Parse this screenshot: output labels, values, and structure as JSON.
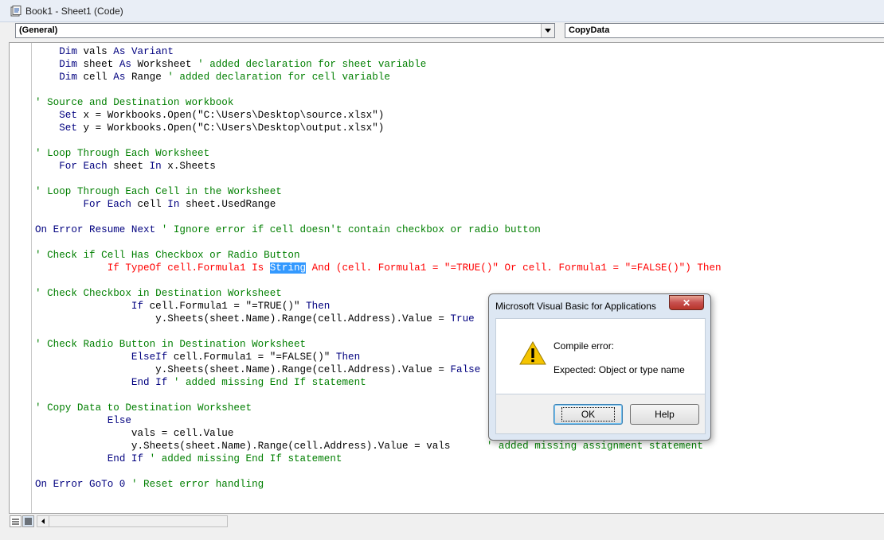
{
  "window": {
    "title": "Book1 - Sheet1 (Code)"
  },
  "combos": {
    "object_value": "(General)",
    "procedure_value": "CopyData"
  },
  "code_lines": [
    [
      {
        "t": "    ",
        "c": "pl"
      },
      {
        "t": "Dim",
        "c": "kw"
      },
      {
        "t": " vals ",
        "c": "pl"
      },
      {
        "t": "As",
        "c": "kw"
      },
      {
        "t": " ",
        "c": "pl"
      },
      {
        "t": "Variant",
        "c": "kw"
      }
    ],
    [
      {
        "t": "    ",
        "c": "pl"
      },
      {
        "t": "Dim",
        "c": "kw"
      },
      {
        "t": " sheet ",
        "c": "pl"
      },
      {
        "t": "As",
        "c": "kw"
      },
      {
        "t": " Worksheet ",
        "c": "pl"
      },
      {
        "t": "' added declaration for sheet variable",
        "c": "cm"
      }
    ],
    [
      {
        "t": "    ",
        "c": "pl"
      },
      {
        "t": "Dim",
        "c": "kw"
      },
      {
        "t": " cell ",
        "c": "pl"
      },
      {
        "t": "As",
        "c": "kw"
      },
      {
        "t": " Range ",
        "c": "pl"
      },
      {
        "t": "' added declaration for cell variable",
        "c": "cm"
      }
    ],
    [],
    [
      {
        "t": "' Source and Destination workbook",
        "c": "cm"
      }
    ],
    [
      {
        "t": "    ",
        "c": "pl"
      },
      {
        "t": "Set",
        "c": "kw"
      },
      {
        "t": " x = Workbooks.Open(\"C:\\Users\\Desktop\\source.xlsx\")",
        "c": "pl"
      }
    ],
    [
      {
        "t": "    ",
        "c": "pl"
      },
      {
        "t": "Set",
        "c": "kw"
      },
      {
        "t": " y = Workbooks.Open(\"C:\\Users\\Desktop\\output.xlsx\")",
        "c": "pl"
      }
    ],
    [],
    [
      {
        "t": "' Loop Through Each Worksheet",
        "c": "cm"
      }
    ],
    [
      {
        "t": "    ",
        "c": "pl"
      },
      {
        "t": "For Each",
        "c": "kw"
      },
      {
        "t": " sheet ",
        "c": "pl"
      },
      {
        "t": "In",
        "c": "kw"
      },
      {
        "t": " x.Sheets",
        "c": "pl"
      }
    ],
    [],
    [
      {
        "t": "' Loop Through Each Cell in the Worksheet",
        "c": "cm"
      }
    ],
    [
      {
        "t": "        ",
        "c": "pl"
      },
      {
        "t": "For Each",
        "c": "kw"
      },
      {
        "t": " cell ",
        "c": "pl"
      },
      {
        "t": "In",
        "c": "kw"
      },
      {
        "t": " sheet.UsedRange",
        "c": "pl"
      }
    ],
    [],
    [
      {
        "t": "On Error Resume Next",
        "c": "kw"
      },
      {
        "t": " ",
        "c": "pl"
      },
      {
        "t": "' Ignore error if cell doesn't contain checkbox or radio button",
        "c": "cm"
      }
    ],
    [],
    [
      {
        "t": "' Check if Cell Has Checkbox or Radio Button",
        "c": "cm"
      }
    ],
    [
      {
        "t": "            If TypeOf cell.Formula1 Is ",
        "c": "err"
      },
      {
        "t": "String",
        "c": "sel"
      },
      {
        "t": " And (cell. Formula1 = \"=TRUE()\" Or cell. Formula1 = \"=FALSE()\") Then",
        "c": "err"
      }
    ],
    [],
    [
      {
        "t": "' Check Checkbox in Destination Worksheet",
        "c": "cm"
      }
    ],
    [
      {
        "t": "                ",
        "c": "pl"
      },
      {
        "t": "If",
        "c": "kw"
      },
      {
        "t": " cell.Formula1 = \"=TRUE()\" ",
        "c": "pl"
      },
      {
        "t": "Then",
        "c": "kw"
      }
    ],
    [
      {
        "t": "                    y.Sheets(sheet.Name).Range(cell.Address).Value = ",
        "c": "pl"
      },
      {
        "t": "True",
        "c": "kw"
      }
    ],
    [],
    [
      {
        "t": "' Check Radio Button in Destination Worksheet",
        "c": "cm"
      }
    ],
    [
      {
        "t": "                ",
        "c": "pl"
      },
      {
        "t": "ElseIf",
        "c": "kw"
      },
      {
        "t": " cell.Formula1 = \"=FALSE()\" ",
        "c": "pl"
      },
      {
        "t": "Then",
        "c": "kw"
      }
    ],
    [
      {
        "t": "                    y.Sheets(sheet.Name).Range(cell.Address).Value = ",
        "c": "pl"
      },
      {
        "t": "False",
        "c": "kw"
      }
    ],
    [
      {
        "t": "                ",
        "c": "pl"
      },
      {
        "t": "End If",
        "c": "kw"
      },
      {
        "t": " ",
        "c": "pl"
      },
      {
        "t": "' added missing End If statement",
        "c": "cm"
      }
    ],
    [],
    [
      {
        "t": "' Copy Data to Destination Worksheet",
        "c": "cm"
      }
    ],
    [
      {
        "t": "            ",
        "c": "pl"
      },
      {
        "t": "Else",
        "c": "kw"
      }
    ],
    [
      {
        "t": "                vals = cell.Value",
        "c": "pl"
      }
    ],
    [
      {
        "t": "                y.Sheets(sheet.Name).Range(cell.Address).Value = vals      ",
        "c": "pl"
      },
      {
        "t": "' added missing assignment statement",
        "c": "cm"
      }
    ],
    [
      {
        "t": "            ",
        "c": "pl"
      },
      {
        "t": "End If",
        "c": "kw"
      },
      {
        "t": " ",
        "c": "pl"
      },
      {
        "t": "' added missing End If statement",
        "c": "cm"
      }
    ],
    [],
    [
      {
        "t": "On Error GoTo 0",
        "c": "kw"
      },
      {
        "t": " ",
        "c": "pl"
      },
      {
        "t": "' Reset error handling",
        "c": "cm"
      }
    ]
  ],
  "dialog": {
    "title": "Microsoft Visual Basic for Applications",
    "close_glyph": "✕",
    "message_title": "Compile error:",
    "message_detail": "Expected: Object or type name",
    "ok_label": "OK",
    "help_label": "Help",
    "icon": "warning-icon"
  },
  "colors": {
    "keyword": "#00007f",
    "comment": "#007f00",
    "error_line": "#ff0000",
    "selection": "#3399ff"
  }
}
